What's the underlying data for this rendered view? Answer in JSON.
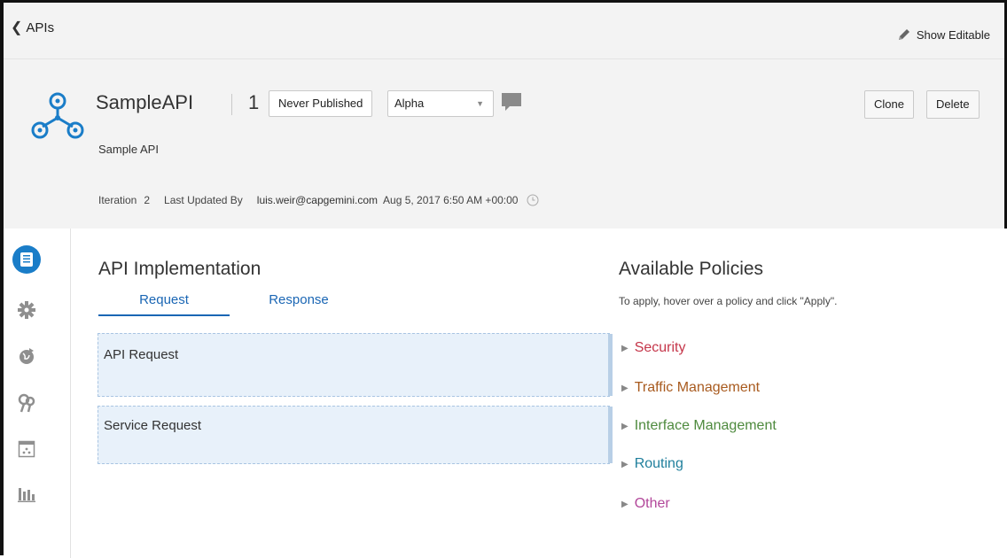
{
  "topbar": {
    "back_label": "APIs",
    "show_editable_label": "Show Editable"
  },
  "api": {
    "name": "SampleAPI",
    "version": "1",
    "publish_status": "Never Published",
    "stage": "Alpha",
    "description": "Sample API",
    "iteration_label": "Iteration",
    "iteration_value": "2",
    "last_updated_label": "Last Updated By",
    "updated_by": "luis.weir@capgemini.com",
    "updated_at": "Aug 5, 2017 6:50 AM +00:00"
  },
  "actions": {
    "clone_label": "Clone",
    "delete_label": "Delete"
  },
  "nav": {
    "items": [
      {
        "icon": "api-implementation-icon",
        "active": true
      },
      {
        "icon": "settings-icon",
        "active": false
      },
      {
        "icon": "deployments-icon",
        "active": false
      },
      {
        "icon": "grants-icon",
        "active": false
      },
      {
        "icon": "portal-icon",
        "active": false
      },
      {
        "icon": "analytics-icon",
        "active": false
      }
    ]
  },
  "implementation": {
    "title": "API Implementation",
    "tabs": {
      "request": "Request",
      "response": "Response"
    },
    "boxes": {
      "api_request": "API Request",
      "service_request": "Service Request"
    }
  },
  "policies": {
    "title": "Available Policies",
    "hint": "To apply, hover over a policy and click \"Apply\".",
    "items": [
      {
        "label": "Security",
        "color": "#c5364a"
      },
      {
        "label": "Traffic Management",
        "color": "#a85a1e"
      },
      {
        "label": "Interface Management",
        "color": "#4e8a3e"
      },
      {
        "label": "Routing",
        "color": "#1f7f9c"
      },
      {
        "label": "Other",
        "color": "#b2479a"
      }
    ]
  },
  "colors": {
    "accent": "#1a7dc8",
    "link": "#1a66b4"
  }
}
